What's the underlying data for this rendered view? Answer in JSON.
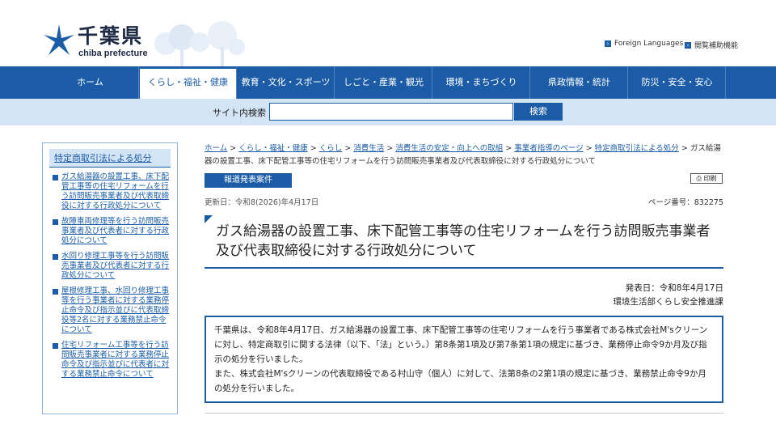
{
  "header": {
    "logo_jp": "千葉県",
    "logo_en": "chiba prefecture",
    "util_links": [
      "Foreign Languages",
      "閲覧補助機能"
    ]
  },
  "nav": {
    "items": [
      "ホーム",
      "くらし・福祉・健康",
      "教育・文化・スポーツ",
      "しごと・産業・観光",
      "環境・まちづくり",
      "県政情報・統計",
      "防災・安全・安心"
    ]
  },
  "search": {
    "label": "サイト内検索",
    "placeholder": "",
    "button": "検索"
  },
  "sidebar": {
    "title": "特定商取引法による処分",
    "items": [
      "ガス給湯器の設置工事、床下配管工事等の住宅リフォームを行う訪問販売事業者及び代表取締役に対する行政処分について",
      "故障車両修理等を行う訪問販売事業者及び代表者に対する行政処分について",
      "水回り修理工事等を行う訪問販売事業者及び代表者に対する行政処分について",
      "屋根修理工事、水回り修理工事等を行う事業者に対する業務停止命令及び指示並びに代表取締役等2名に対する業務禁止命令について",
      "住宅リフォーム工事等を行う訪問販売事業者に対する業務停止命令及び指示並びに代表者に対する業務禁止命令について"
    ]
  },
  "breadcrumb": {
    "links": [
      "ホーム",
      "くらし・福祉・健康",
      "くらし",
      "消費生活",
      "消費生活の安定・向上への取組",
      "事業者指導のページ",
      "特定商取引法による処分"
    ],
    "separator": " > ",
    "current": "ガス給湯器の設置工事、床下配管工事等の住宅リフォームを行う訪問販売事業者及び代表取締役に対する行政処分について"
  },
  "page": {
    "category_button": "報道発表案件",
    "print_label": "印刷",
    "updated": "更新日：令和8(2026)年4月17日",
    "page_number": "ページ番号：832275",
    "title": "ガス給湯器の設置工事、床下配管工事等の住宅リフォームを行う訪問販売事業者及び代表取締役に対する行政処分について",
    "issue_date": "発表日：令和8年4月17日",
    "department": "環境生活部くらし安全推進課",
    "body_1": "千葉県は、令和8年4月17日、ガス給湯器の設置工事、床下配管工事等の住宅リフォームを行う事業者である株式会社M'sクリーンに対し、特定商取引に関する法律（以下、「法」という。）第8条第1項及び第7条第1項の規定に基づき、業務停止命令9か月及び指示の処分を行いました。",
    "body_2": "また、株式会社M'sクリーンの代表取締役である村山守（個人）に対して、法第8条の2第1項の規定に基づき、業務禁止命令9か月の処分を行いました。"
  },
  "colors": {
    "brand_blue": "#1c5ca6",
    "light_blue": "#d3e4f5"
  }
}
